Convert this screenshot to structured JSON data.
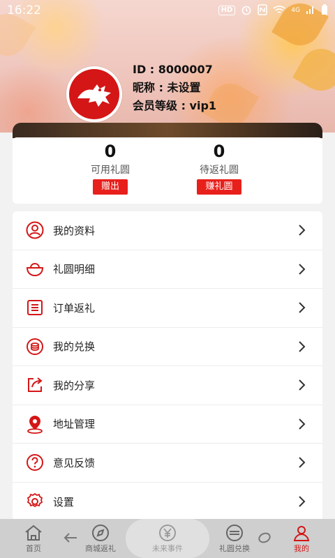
{
  "status_bar": {
    "time": "16:22",
    "hd_label": "HD",
    "network_label": "4G"
  },
  "profile": {
    "id_text": "ID : 8000007",
    "nickname_text": "昵称 : 未设置",
    "level_text": "会员等级 : vip1"
  },
  "balance": {
    "available": {
      "value": "0",
      "label": "可用礼圆",
      "button": "赠出"
    },
    "pending": {
      "value": "0",
      "label": "待返礼圆",
      "button": "赚礼圆"
    }
  },
  "menu": [
    {
      "label": "我的资料",
      "icon": "user-icon"
    },
    {
      "label": "礼圆明细",
      "icon": "ingot-icon"
    },
    {
      "label": "订单返礼",
      "icon": "order-list-icon"
    },
    {
      "label": "我的兑换",
      "icon": "exchange-icon"
    },
    {
      "label": "我的分享",
      "icon": "share-icon"
    },
    {
      "label": "地址管理",
      "icon": "location-icon"
    },
    {
      "label": "意见反馈",
      "icon": "feedback-icon"
    },
    {
      "label": "设置",
      "icon": "settings-icon"
    }
  ],
  "bottom_nav": [
    {
      "label": "首页",
      "icon": "home-icon"
    },
    {
      "label": "商城返礼",
      "icon": "compass-icon"
    },
    {
      "label": "未来事件",
      "icon": "yen-icon"
    },
    {
      "label": "礼圆兑换",
      "icon": "exchange-circle-icon"
    },
    {
      "label": "我的",
      "icon": "profile-icon"
    }
  ],
  "colors": {
    "accent": "#d41616",
    "button_red": "#e8201b",
    "nav_bg": "#cfcfcf"
  }
}
